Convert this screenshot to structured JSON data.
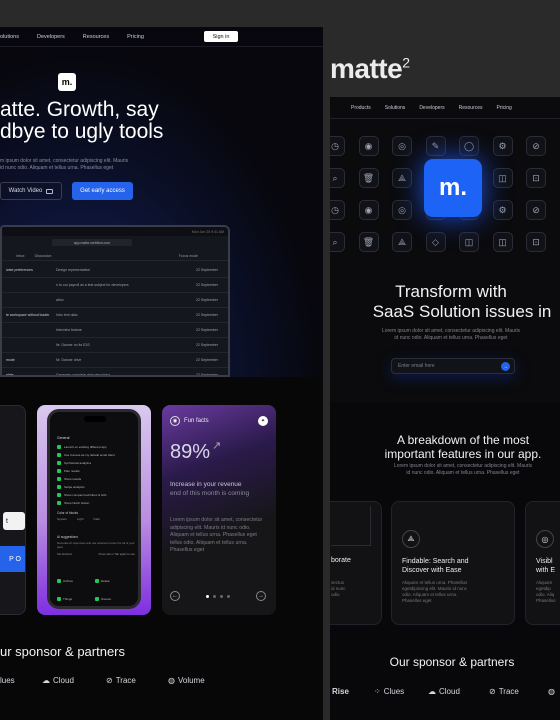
{
  "left_panel": {
    "nav": {
      "items": [
        "olutions",
        "Developers",
        "Resources",
        "Pricing"
      ],
      "signin": "Sign in"
    },
    "logo": "m.",
    "hero": {
      "title_line1": "atte. Growth, say",
      "title_line2": "dbye to ugly tools",
      "subtitle_line1": "m ipsum dolor sit amet, consectetur adipiscing elit. Mauris",
      "subtitle_line2": "id nunc odio. Aliquam et tellus urna. Phasellus eget",
      "watch_video": "Watch Video",
      "early_access": "Get early access"
    },
    "laptop": {
      "url": "app.matte.webflow.com",
      "date": "Mon Jun 25 9:41 AM",
      "header_label": "Focus mode",
      "tabs": [
        "Inbox",
        "Discussion"
      ],
      "rows": [
        {
          "title": "ivate preferences",
          "desc": "Design representative",
          "date": "22 September"
        },
        {
          "title": "",
          "desc": "n to our payroll as a test subject for developers",
          "date": "22 September"
        },
        {
          "title": "",
          "desc": "ation",
          "date": "22 September"
        },
        {
          "title": "te workspace without loader",
          "desc": "Intro text data",
          "date": "22 September"
        },
        {
          "title": "",
          "desc": "Interview feature",
          "date": "22 September"
        },
        {
          "title": "",
          "desc": "Nr. Dancer on its E3S",
          "date": "22 September"
        },
        {
          "title": "mode",
          "desc": "Nr. Dancer drive",
          "date": "22 September"
        },
        {
          "title": "elete",
          "desc": "Generate complete data descriptor",
          "date": "22 September"
        }
      ]
    },
    "phone": {
      "section_general": "General",
      "checklist": [
        "Launch on existing different app",
        "Use Canvas as my default email client",
        "Synthetical analytics",
        "Plan results",
        "Show results",
        "Swipe analytics",
        "Show compact text/inbox & Gifs",
        "Show Notch button"
      ],
      "color_label": "Color of blocks",
      "color_options": [
        "System",
        "Light",
        "Dark"
      ],
      "ai_section": "AI suggestions",
      "ai_desc": "Generate AI responses and use selected content for all of your pass",
      "shortcut_label": "Set shortcut",
      "shortcut_value": "Press tab or Tab again to use",
      "bottom_checks": [
        "Archive",
        "Delete",
        "Things",
        "Snooze"
      ]
    },
    "card_left": {
      "letter_t": "t",
      "button": "P O"
    },
    "fun_facts": {
      "label": "Fun facts",
      "percent": "89%",
      "increase_line1": "Increase in your revenue",
      "increase_line2": "end of this month is coming",
      "body": "Lorem ipsum dolor sit amet, consectetur adipiscing elit. Mauris id nunc odio. Aliquam et tellus urna. Phasellus eget tellus odio. Aliquam et tellus urna. Phasellus eget"
    },
    "sponsors_title": "ur sponsor & partners",
    "sponsors": [
      "lues",
      "Cloud",
      "Trace",
      "Volume"
    ]
  },
  "right_panel": {
    "brand": "matte",
    "brand_sup": "2",
    "nav": [
      "Products",
      "Solutions",
      "Developers",
      "Resources",
      "Pricing"
    ],
    "blue_logo": "m.",
    "transform_line1": "Transform with",
    "transform_line2": "SaaS Solution issues in",
    "transform_sub1": "Lorem ipsum dolor sit amet, consectetur adipiscing elit. Mauris",
    "transform_sub2": "id nunc odio. Aliquam et tellus urna. Phasellus eget",
    "email_placeholder": "Enter email here",
    "breakdown_line1": "A breakdown of the most",
    "breakdown_line2": "important features in our app.",
    "breakdown_sub1": "Lorem ipsum dolor sit amet, consectetur adipiscing elit. Mauris",
    "breakdown_sub2": "id nunc odio. Aliquam et tellus urna. Phasellus eget",
    "features": [
      {
        "title1": "borate",
        "title2": "",
        "body": "sectus\nid nunc\nodio"
      },
      {
        "title1": "Findable: Search and",
        "title2": "Discover with Ease",
        "body": "Aliquam et tellus urna. Phasellus\negetdipiscing elit. Mauris id nunc\nodio. Aliquam et tellus urna.\nPhasellus eget"
      },
      {
        "title1": "Visibl",
        "title2": "with E",
        "body": "Aliquam\negetdip\nodio. Aliq\nPhasellus"
      }
    ],
    "sponsors_title": "Our sponsor & partners",
    "sponsors": [
      "Rise",
      "Clues",
      "Cloud",
      "Trace"
    ]
  }
}
